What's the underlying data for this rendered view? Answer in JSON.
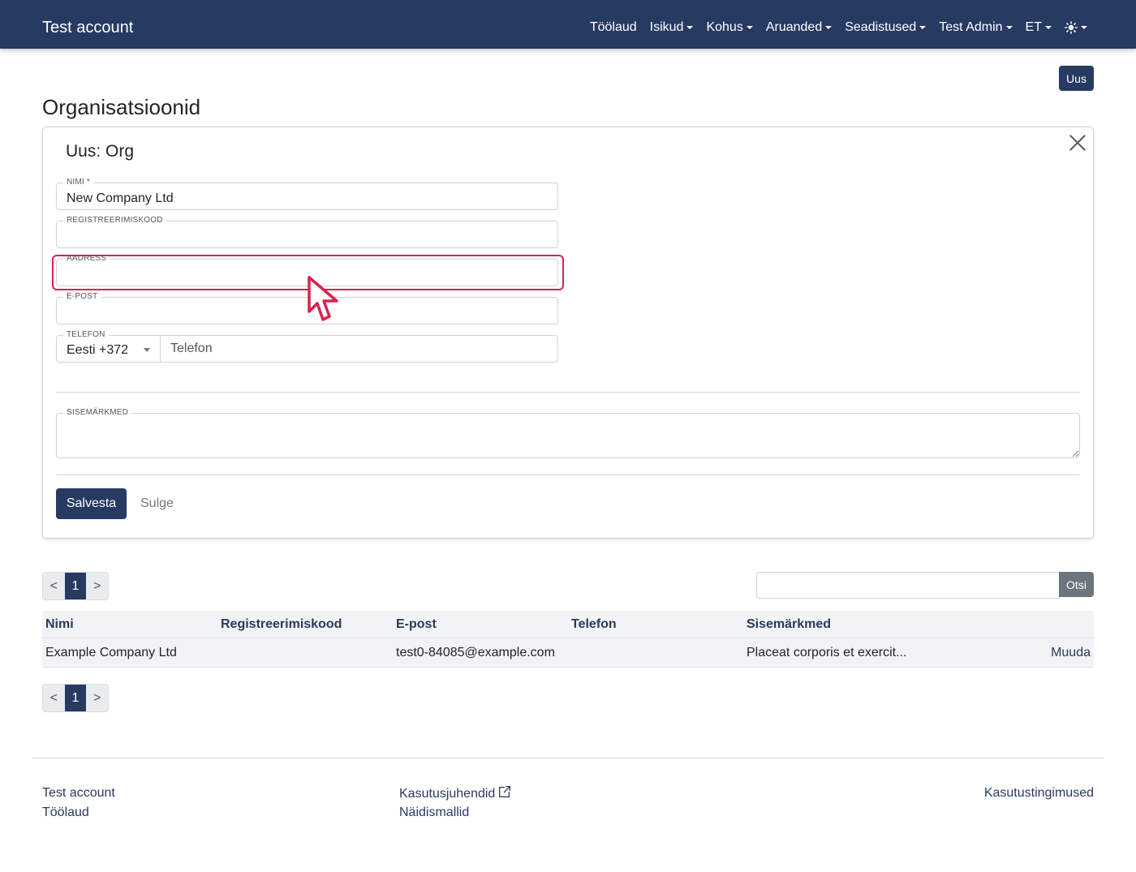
{
  "navbar": {
    "brand": "Test account",
    "items": [
      {
        "label": "Töölaud",
        "dropdown": false
      },
      {
        "label": "Isikud",
        "dropdown": true
      },
      {
        "label": "Kohus",
        "dropdown": true
      },
      {
        "label": "Aruanded",
        "dropdown": true
      },
      {
        "label": "Seadistused",
        "dropdown": true
      },
      {
        "label": "Test Admin",
        "dropdown": true
      },
      {
        "label": "ET",
        "dropdown": true
      }
    ],
    "theme_icon": "sun-icon"
  },
  "page": {
    "new_button": "Uus",
    "title": "Organisatsioonid"
  },
  "form": {
    "title": "Uus: Org",
    "fields": {
      "name": {
        "label": "NIMI *",
        "value": "New Company Ltd"
      },
      "regcode": {
        "label": "REGISTREERIMISKOOD",
        "value": ""
      },
      "address": {
        "label": "AADRESS",
        "value": ""
      },
      "email": {
        "label": "E-POST",
        "value": ""
      },
      "phone": {
        "label": "TELEFON",
        "country": "Eesti +372",
        "placeholder": "Telefon"
      },
      "notes": {
        "label": "SISEMÄRKMED",
        "value": ""
      }
    },
    "save_button": "Salvesta",
    "close_link": "Sulge"
  },
  "pagination": {
    "prev": "<",
    "current": "1",
    "next": ">"
  },
  "search": {
    "value": "",
    "button": "Otsi"
  },
  "table": {
    "headers": [
      "Nimi",
      "Registreerimiskood",
      "E-post",
      "Telefon",
      "Sisemärkmed"
    ],
    "rows": [
      {
        "name": "Example Company Ltd",
        "regcode": "",
        "email": "test0-84085@example.com",
        "phone": "",
        "notes": "Placeat corporis et exercit...",
        "action": "Muuda"
      }
    ]
  },
  "footer": {
    "left": [
      "Test account",
      "Töölaud"
    ],
    "middle": [
      "Kasutusjuhendid",
      "Näidismallid"
    ],
    "right": "Kasutustingimused"
  },
  "colors": {
    "primary": "#273a61",
    "highlight": "#d6244f",
    "secondary": "#6c757d"
  }
}
